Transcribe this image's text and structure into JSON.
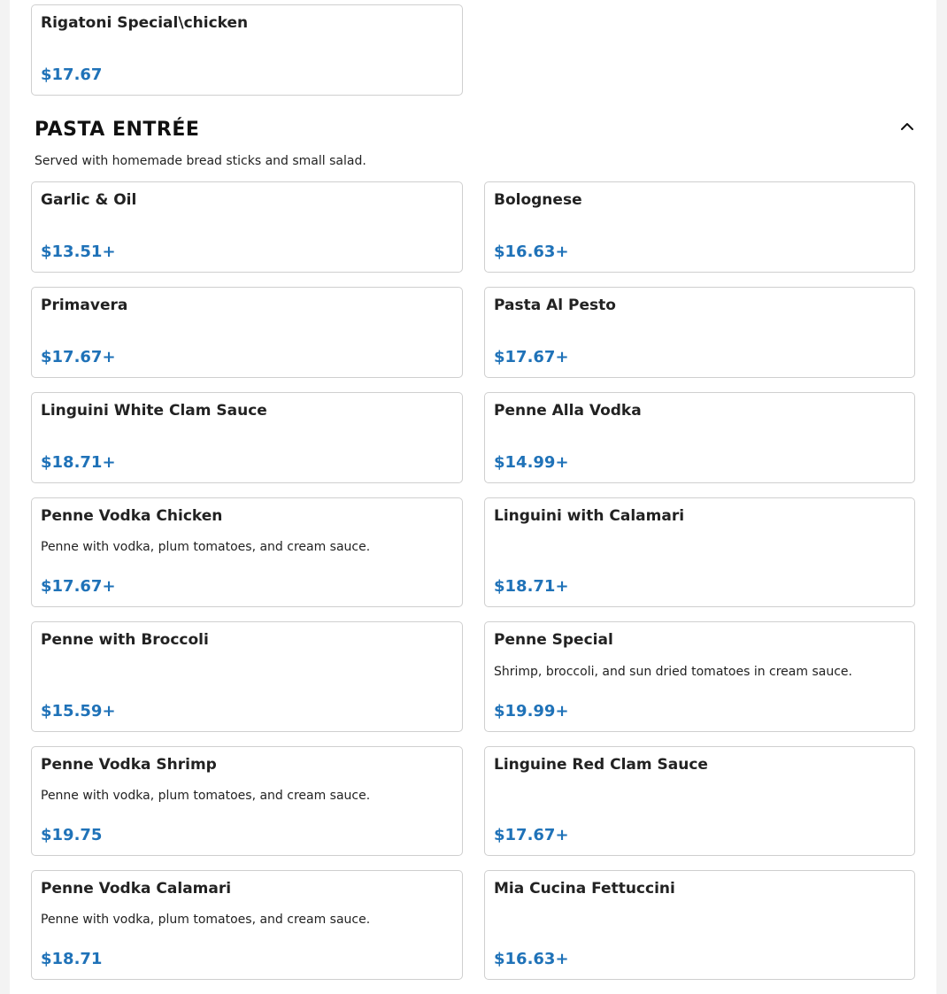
{
  "prev_section": {
    "item": {
      "name": "Rigatoni Special\\chicken",
      "price": "$17.67"
    }
  },
  "section": {
    "title": "PASTA ENTRÉE",
    "subtitle": "Served with homemade bread sticks and small salad.",
    "collapse_icon": "chevron-up-icon",
    "items": [
      {
        "name": "Garlic & Oil",
        "price": "$13.51+"
      },
      {
        "name": "Bolognese",
        "price": "$16.63+"
      },
      {
        "name": "Primavera",
        "price": "$17.67+"
      },
      {
        "name": "Pasta Al Pesto",
        "price": "$17.67+"
      },
      {
        "name": "Linguini White Clam Sauce",
        "price": "$18.71+"
      },
      {
        "name": "Penne Alla Vodka",
        "price": "$14.99+"
      },
      {
        "name": "Penne Vodka Chicken",
        "description": "Penne with vodka, plum tomatoes, and cream sauce.",
        "price": "$17.67+"
      },
      {
        "name": "Linguini with Calamari",
        "price": "$18.71+"
      },
      {
        "name": "Penne with Broccoli",
        "price": "$15.59+"
      },
      {
        "name": "Penne Special",
        "description": "Shrimp, broccoli, and sun dried tomatoes in cream sauce.",
        "price": "$19.99+"
      },
      {
        "name": "Penne Vodka Shrimp",
        "description": "Penne with vodka, plum tomatoes, and cream sauce.",
        "price": "$19.75"
      },
      {
        "name": "Linguine Red Clam Sauce",
        "price": "$17.67+"
      },
      {
        "name": "Penne Vodka Calamari",
        "description": "Penne with vodka, plum tomatoes, and cream sauce.",
        "price": "$18.71"
      },
      {
        "name": "Mia Cucina Fettuccini",
        "price": "$16.63+"
      }
    ]
  },
  "colors": {
    "price": "#1f72b8",
    "border": "#cfcfcf",
    "background": "#f3f3f3"
  }
}
